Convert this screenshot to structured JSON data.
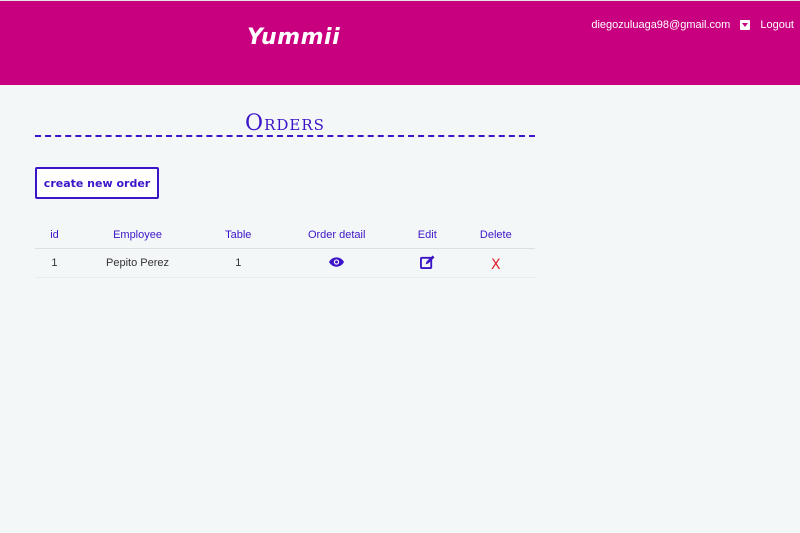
{
  "header": {
    "brand": "Yummii",
    "user_email": "diegozuluaga98@gmail.com",
    "dropdown_icon": "caret-down-icon",
    "logout_label": "Logout"
  },
  "page": {
    "title": "Orders",
    "create_button_label": "create new order"
  },
  "table": {
    "columns": [
      "id",
      "Employee",
      "Table",
      "Order detail",
      "Edit",
      "Delete"
    ],
    "rows": [
      {
        "id": "1",
        "employee": "Pepito Perez",
        "table": "1",
        "order_detail_icon": "eye-icon",
        "edit_icon": "edit-icon",
        "delete_label": "X"
      }
    ]
  },
  "colors": {
    "header_bg": "#c8007f",
    "accent": "#3c15c8",
    "delete": "#e0202f",
    "page_bg": "#f4f7f8"
  }
}
